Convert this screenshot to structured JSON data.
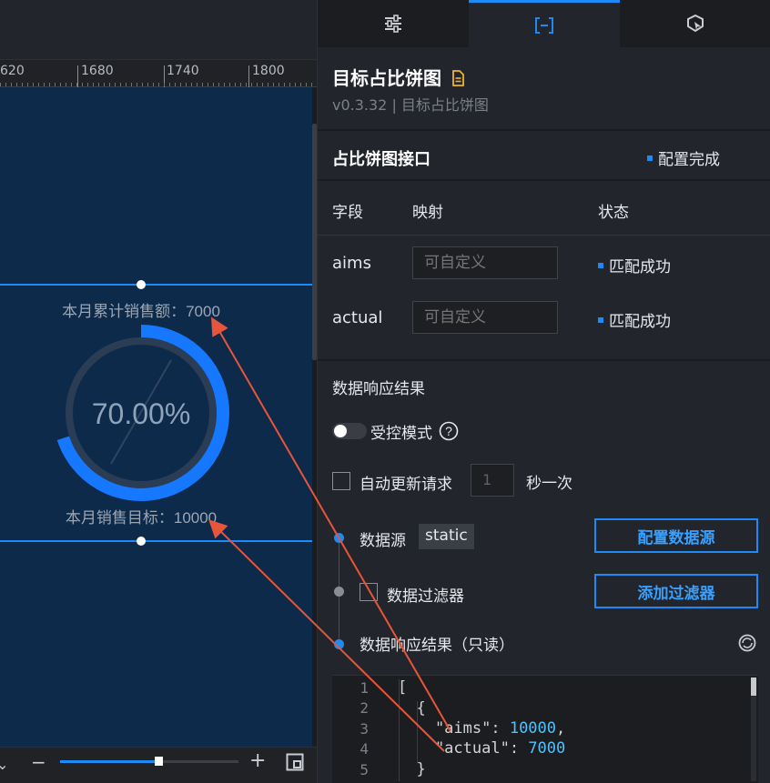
{
  "ruler": {
    "ticks": [
      "620",
      "1680",
      "1740",
      "1800"
    ]
  },
  "widget": {
    "top_label": "本月累计销售额：7000",
    "percent": "70.00%",
    "bottom_label": "本月销售目标：10000",
    "actual": 7000,
    "target": 10000,
    "ratio": 0.7
  },
  "zoom": {
    "level": 0.55
  },
  "panel": {
    "component_title": "目标占比饼图",
    "version_line": "v0.3.32 | 目标占比饼图",
    "interface_title": "占比饼图接口",
    "interface_status": "配置完成",
    "col_field": "字段",
    "col_mapping": "映射",
    "col_status": "状态",
    "fields": [
      {
        "name": "aims",
        "placeholder": "可自定义",
        "status": "匹配成功"
      },
      {
        "name": "actual",
        "placeholder": "可自定义",
        "status": "匹配成功"
      }
    ],
    "response_title": "数据响应结果",
    "controlled_mode": "受控模式",
    "auto_update_label": "自动更新请求",
    "interval_value": "1",
    "interval_unit": "秒一次",
    "datasource_label": "数据源",
    "datasource_type": "static",
    "config_datasource_btn": "配置数据源",
    "filter_label": "数据过滤器",
    "add_filter_btn": "添加过滤器",
    "readonly_label": "数据响应结果（只读）"
  },
  "code": {
    "line_numbers": [
      "1",
      "2",
      "3",
      "4",
      "5"
    ],
    "l1": "[",
    "l2": "  {",
    "l3_key": "    \"aims\": ",
    "l3_val": "10000",
    "l3_tail": ",",
    "l4_key": "    \"actual\": ",
    "l4_val": "7000",
    "l5": "  }"
  },
  "colors": {
    "accent": "#1d8af5",
    "canvas_bg": "#0e2a4b",
    "annotation_arrow": "#e8553a"
  }
}
